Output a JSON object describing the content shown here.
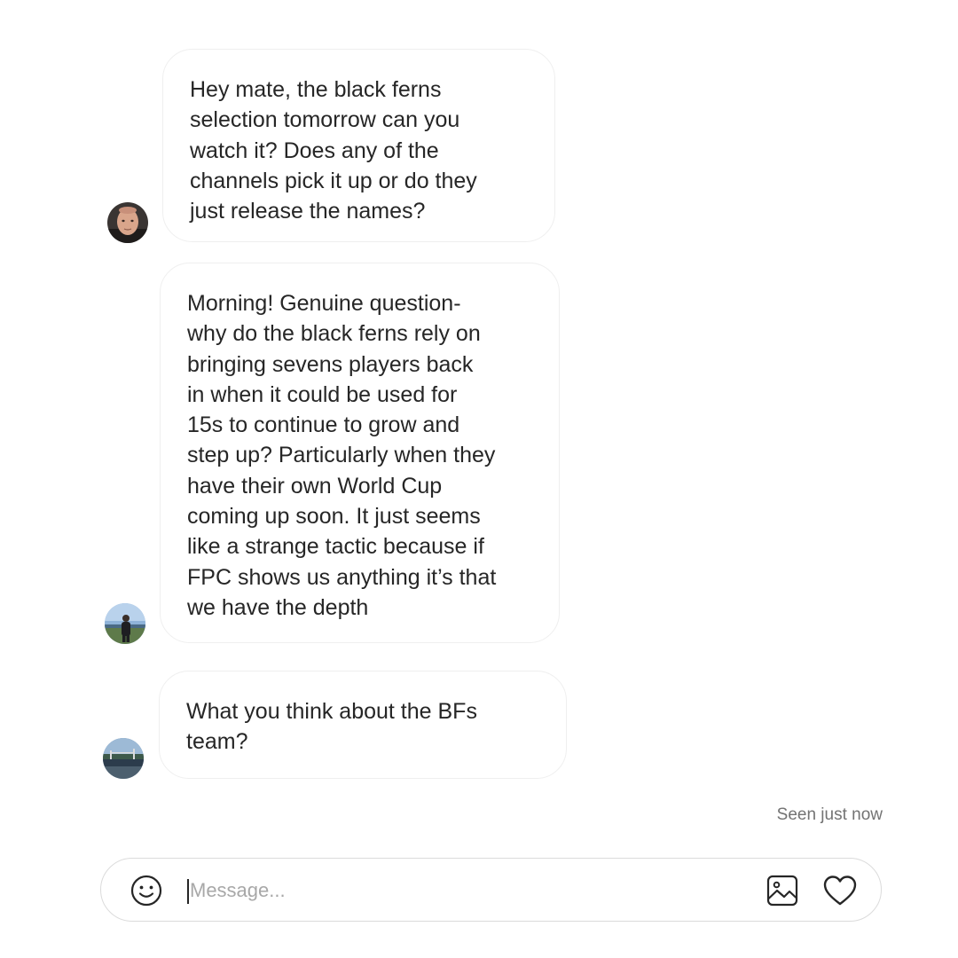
{
  "messages": [
    {
      "text": "Hey mate, the black ferns\nselection tomorrow can you\nwatch it? Does any of the\nchannels pick it up or do they\njust release the names?",
      "avatar": "face-photo"
    },
    {
      "text": "Morning! Genuine question-\nwhy do the black ferns rely on\nbringing sevens players back\nin when it could be used for\n15s to continue to grow and\nstep up? Particularly when they\nhave their own World Cup\ncoming up soon. It just seems\nlike a strange tactic because if\nFPC shows us anything it’s that\nwe have the depth",
      "avatar": "person-outdoor-photo"
    },
    {
      "text": "What you think about the BFs\nteam?",
      "avatar": "landscape-photo"
    }
  ],
  "status": {
    "seen": "Seen just now"
  },
  "composer": {
    "placeholder": "Message...",
    "value": "",
    "icons": [
      "emoji-icon",
      "image-icon",
      "heart-icon"
    ]
  },
  "colors": {
    "text": "#262626",
    "bubble_border": "#efefef",
    "muted": "#737373",
    "placeholder": "#a8a8a8"
  }
}
